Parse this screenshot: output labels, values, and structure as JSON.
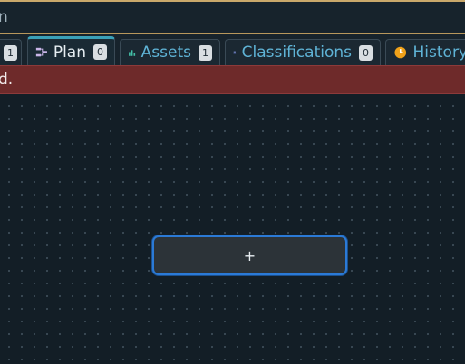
{
  "search": {
    "text": "n"
  },
  "tabs": [
    {
      "label": "",
      "badge": "1"
    },
    {
      "label": "Plan",
      "badge": "0",
      "icon": "plan-icon",
      "active": true
    },
    {
      "label": "Assets",
      "badge": "1",
      "icon": "assets-icon"
    },
    {
      "label": "Classifications",
      "badge": "0",
      "icon": "classifications-icon"
    },
    {
      "label": "History",
      "icon": "history-icon"
    }
  ],
  "banner": {
    "text": "d."
  },
  "canvas": {
    "add_label": "+"
  },
  "colors": {
    "background": "#131e26",
    "banner": "#6e2a2a",
    "accent": "#2b7ad6",
    "tab_text": "#5fb3d6"
  }
}
